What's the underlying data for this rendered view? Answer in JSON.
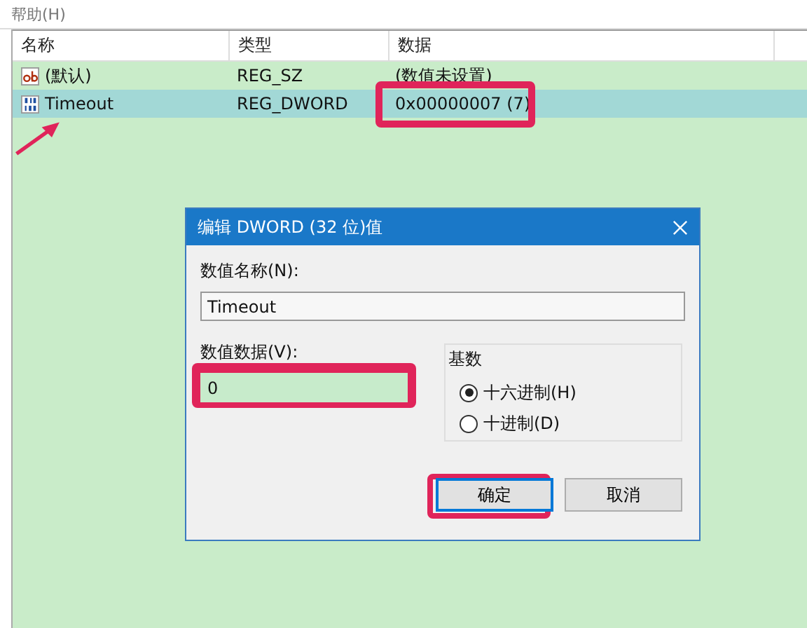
{
  "menu": [
    "帮助(H)"
  ],
  "table": {
    "columns": [
      "名称",
      "类型",
      "数据"
    ],
    "rows": [
      {
        "kind": "string",
        "name": "(默认)",
        "type": "REG_SZ",
        "data": "(数值未设置)",
        "selected": false
      },
      {
        "kind": "binary",
        "name": "Timeout",
        "type": "REG_DWORD",
        "data": "0x00000007 (7)",
        "selected": true
      }
    ]
  },
  "dialog": {
    "title": "编辑 DWORD (32 位)值",
    "name_label": "数值名称(N):",
    "name_value": "Timeout",
    "data_label": "数值数据(V):",
    "data_value": "0",
    "base": {
      "title": "基数",
      "options": [
        {
          "label": "十六进制(H)",
          "selected": true
        },
        {
          "label": "十进制(D)",
          "selected": false
        }
      ]
    },
    "buttons": [
      "确定",
      "取消"
    ]
  }
}
